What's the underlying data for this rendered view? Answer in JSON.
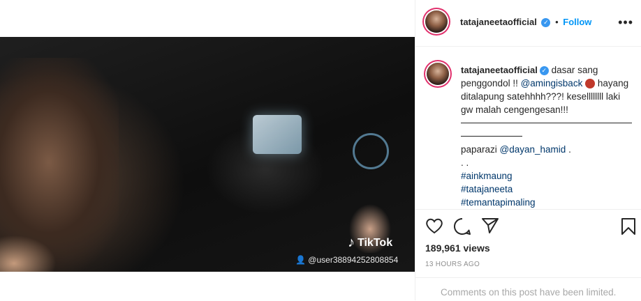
{
  "post": {
    "username": "tatajaneetaofficial",
    "follow_label": "Follow",
    "separator": "•",
    "more_label": "•••"
  },
  "media": {
    "watermark_brand": "TikTok",
    "watermark_user": "@user38894252808854"
  },
  "caption": {
    "username": "tatajaneetaofficial",
    "text_1": "dasar sang penggondol !! ",
    "mention_1": "@amingisback",
    "text_2": "hayang ditalapung satehhhh???! kesellllllll laki gw malah cengengesan!!!",
    "text_3": "paparazi ",
    "mention_2": "@dayan_hamid",
    "text_4": " .",
    "dots": ". .",
    "hashtags": [
      "#ainkmaung",
      "#tatajaneeta",
      "#temantapimaling"
    ]
  },
  "stats": {
    "views": "189,961 views",
    "timestamp": "13 HOURS AGO"
  },
  "footer": {
    "limited_text": "Comments on this post have been limited."
  },
  "colors": {
    "link": "#00376b",
    "follow": "#0095f6",
    "verified": "#3897f0"
  },
  "icons": [
    "heart-icon",
    "comment-icon",
    "share-icon",
    "bookmark-icon",
    "tiktok-icon",
    "user-icon",
    "verified-badge-icon"
  ]
}
